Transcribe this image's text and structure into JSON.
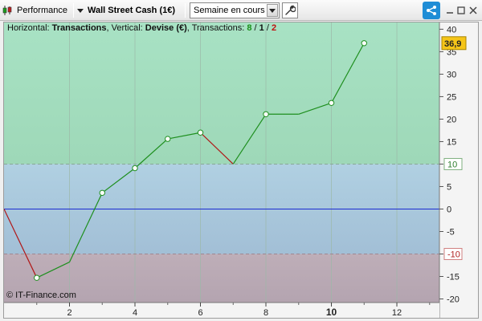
{
  "toolbar": {
    "performance_label": "Performance",
    "instrument_label": "Wall Street Cash (1€)",
    "period_value": "Semaine en cours"
  },
  "legend": {
    "prefix": "Horizontal: ",
    "horizontal": "Transactions",
    "vertical_prefix": ", Vertical: ",
    "vertical": "Devise (€)",
    "tx_prefix": ", Transactions: ",
    "tx_total": "8",
    "sep1": " / ",
    "tx_wins": "1",
    "sep2": " / ",
    "tx_losses": "2"
  },
  "copyright": "© IT-Finance.com",
  "colors": {
    "zone_top": "#a3dfc0",
    "zone_mid": "#a8c8de",
    "zone_bottom": "#b8aab4",
    "up": "#1e8f1e",
    "down": "#b01818",
    "zero_line": "#1b2bd1",
    "current_tag": "#f5c518"
  },
  "chart_data": {
    "type": "line",
    "x": [
      0,
      1,
      2,
      3,
      4,
      5,
      6,
      7,
      8,
      9,
      10,
      11
    ],
    "values": [
      0,
      -15.3,
      -11.8,
      3.6,
      9.1,
      15.6,
      17,
      10,
      21.1,
      21.1,
      23.6,
      36.9
    ],
    "markers": [
      1,
      3,
      4,
      5,
      6,
      8,
      10,
      11
    ],
    "current_value_label": "36,9",
    "x_ticks": [
      2,
      4,
      6,
      8,
      10,
      12
    ],
    "x_tick_labels": [
      "2",
      "4",
      "6",
      "8",
      "10",
      "12"
    ],
    "highlight_x": "10",
    "y_ticks": [
      40,
      35,
      30,
      25,
      20,
      15,
      10,
      5,
      0,
      -5,
      -10,
      -15,
      -20
    ],
    "y_tick_labels": [
      "40",
      "35",
      "30",
      "25",
      "20",
      "15",
      "10",
      "5",
      "0",
      "-5",
      "-10",
      "-15",
      "-20"
    ],
    "xlim": [
      0,
      13.3
    ],
    "ylim": [
      -20.8,
      41.5
    ],
    "upper_band": 10,
    "lower_band": -10,
    "upper_band_label": "10",
    "lower_band_label": "-10",
    "zero_label": "0",
    "grid": true
  }
}
